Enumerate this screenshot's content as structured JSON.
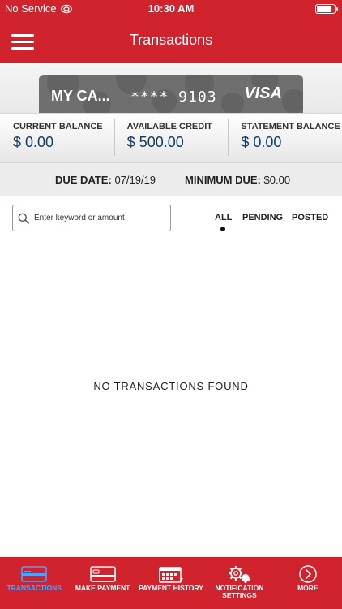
{
  "status": {
    "carrier": "No Service",
    "time": "10:30 AM"
  },
  "nav": {
    "title": "Transactions"
  },
  "card": {
    "name": "MY CA...",
    "number": "**** 9103",
    "brand": "VISA"
  },
  "balances": [
    {
      "label": "CURRENT BALANCE",
      "value": "$ 0.00"
    },
    {
      "label": "AVAILABLE CREDIT",
      "value": "$ 500.00"
    },
    {
      "label": "STATEMENT BALANCE",
      "value": "$ 0.00"
    }
  ],
  "due": {
    "date_label": "DUE DATE:",
    "date_value": "07/19/19",
    "min_label": "MINIMUM DUE:",
    "min_value": "$0.00"
  },
  "search": {
    "placeholder": "Enter keyword or amount",
    "value": ""
  },
  "filters": {
    "all": "ALL",
    "pending": "PENDING",
    "posted": "POSTED",
    "active": "ALL"
  },
  "empty_message": "NO TRANSACTIONS FOUND",
  "tabs": [
    {
      "label": "TRANSACTIONS",
      "icon": "card-icon",
      "active": true
    },
    {
      "label": "MAKE PAYMENT",
      "icon": "credit-card-icon",
      "active": false
    },
    {
      "label": "PAYMENT HISTORY",
      "icon": "calendar-icon",
      "active": false
    },
    {
      "label": "NOTIFICATION SETTINGS",
      "icon": "gear-bell-icon",
      "active": false
    },
    {
      "label": "MORE",
      "icon": "chevron-right-circle-icon",
      "active": false
    }
  ],
  "colors": {
    "brand": "#d0232e",
    "active_tab": "#4aa3ff",
    "balance_value": "#0f3a6a"
  }
}
